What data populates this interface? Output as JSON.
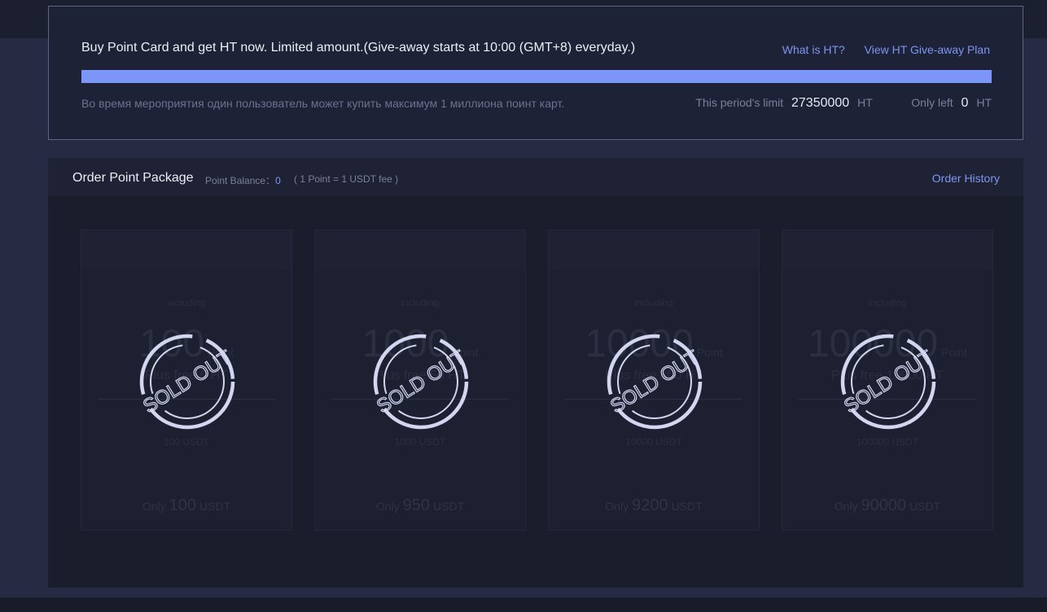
{
  "banner": {
    "title": "Buy Point Card and get HT now. Limited amount.(Give-away starts at 10:00 (GMT+8) everyday.)",
    "link_what_is_ht": "What is HT?",
    "link_giveaway_plan": "View HT Give-away Plan",
    "progress_fraction": 1.0,
    "note": "Во время мероприятия один пользователь может купить максимум 1 миллиона поинт карт.",
    "period_limit_label": "This period's limit",
    "period_limit_value": "27350000",
    "period_limit_unit": "HT",
    "only_left_label": "Only left",
    "only_left_value": "0",
    "only_left_unit": "HT"
  },
  "orders": {
    "title": "Order Point Package",
    "balance_label": "Point Balance：",
    "balance_value": "0",
    "fee_note": "( 1 Point = 1 USDT fee )",
    "history_link": "Order History"
  },
  "packages": [
    {
      "including": "including",
      "points": "100",
      "points_unit": "Point",
      "plus": "Plus free 0 HT",
      "equiv": "100 USDT",
      "price_prefix": "Only",
      "price": "100",
      "price_unit": "USDT",
      "stamp": "SOLD OUT"
    },
    {
      "including": "including",
      "points": "1000",
      "points_unit": "Point",
      "plus": "Plus free 50 HT",
      "equiv": "1000 USDT",
      "price_prefix": "Only",
      "price": "950",
      "price_unit": "USDT",
      "stamp": "SOLD OUT"
    },
    {
      "including": "including",
      "points": "10000",
      "points_unit": "Point",
      "plus": "Plus free 800 HT",
      "equiv": "10000 USDT",
      "price_prefix": "Only",
      "price": "9200",
      "price_unit": "USDT",
      "stamp": "SOLD OUT"
    },
    {
      "including": "including",
      "points": "100000",
      "points_unit": "Point",
      "plus": "Plus free 10000 HT",
      "equiv": "100000 USDT",
      "price_prefix": "Only",
      "price": "90000",
      "price_unit": "USDT",
      "stamp": "SOLD OUT"
    }
  ],
  "colors": {
    "accent": "#7b96f6",
    "link": "#7c95f0",
    "stamp": "#d2d6f0"
  }
}
